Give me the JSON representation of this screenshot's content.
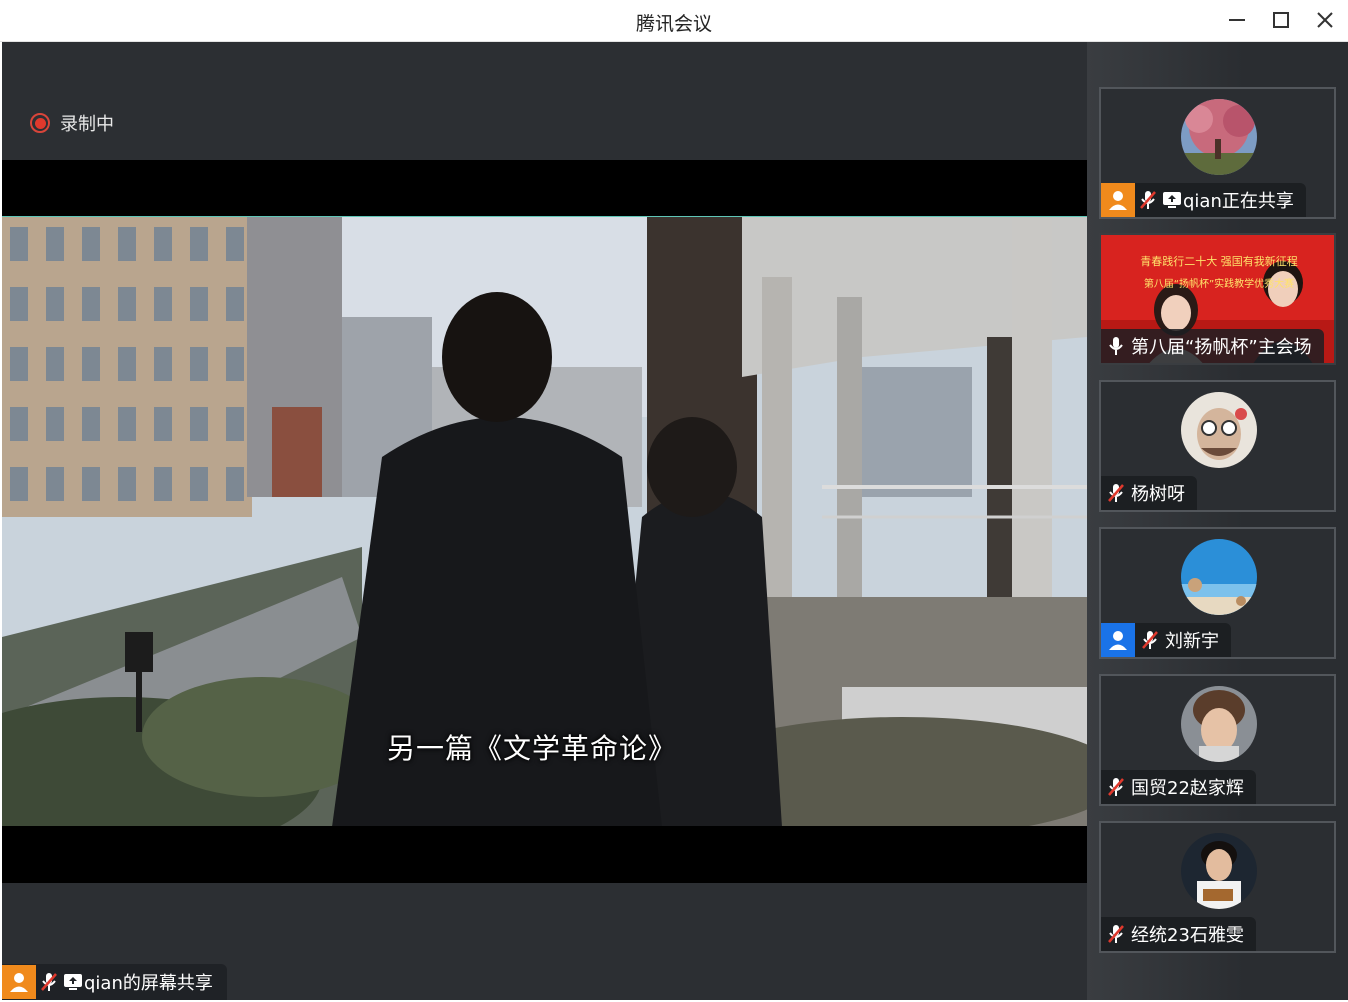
{
  "window": {
    "title": "腾讯会议",
    "minimize": "—",
    "maximize": "☐",
    "close": "✕"
  },
  "stage": {
    "recording": "录制中",
    "subtitle": "另一篇《文学革命论》",
    "share_label": "qian的屏幕共享"
  },
  "banner": {
    "line1": "青春践行二十大 强国有我新征程",
    "line2": "第八届“扬帆杯”实践教学优秀大赛"
  },
  "participants": [
    {
      "name": "qian正在共享",
      "avatar_icon": "user-icon",
      "badge_color": "#f08a1c",
      "muted": true,
      "sharing": true
    },
    {
      "name": "第八届“扬帆杯”主会场",
      "avatar_icon": "",
      "muted": false,
      "sharing": false
    },
    {
      "name": "杨树呀",
      "muted": true,
      "sharing": false
    },
    {
      "name": "刘新宇",
      "avatar_icon": "user-icon",
      "badge_color": "#1a73e8",
      "muted": true,
      "sharing": false
    },
    {
      "name": "国贸22赵家辉",
      "muted": true,
      "sharing": false
    },
    {
      "name": "经统23石雅雯",
      "muted": true,
      "sharing": false
    }
  ],
  "colors": {
    "accent_record": "#e0392d",
    "teal_line": "#5fc6b7"
  }
}
